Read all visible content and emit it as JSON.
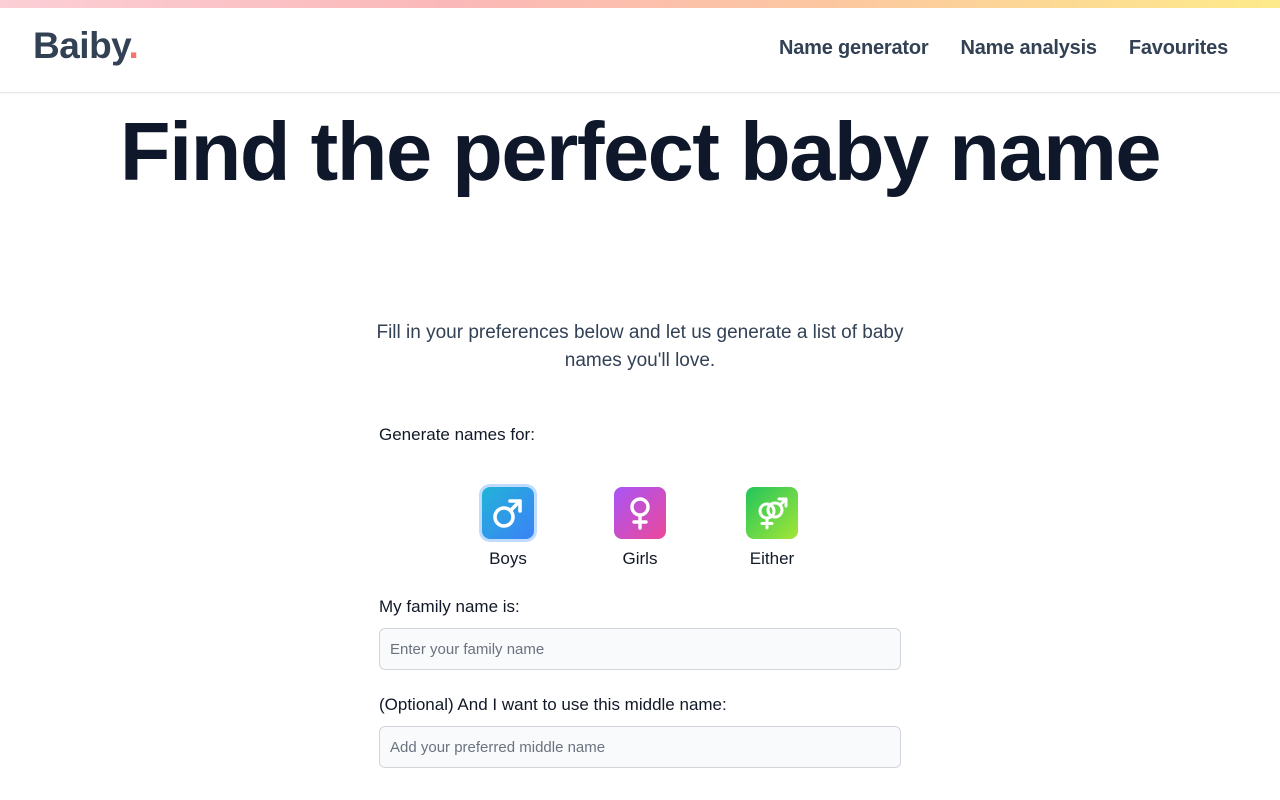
{
  "brand": {
    "name": "Baiby",
    "dot": ".",
    "dot_color": "#f87171"
  },
  "nav": {
    "items": [
      {
        "label": "Name generator"
      },
      {
        "label": "Name analysis"
      },
      {
        "label": "Favourites"
      }
    ]
  },
  "hero": {
    "title": "Find the perfect baby name",
    "subtitle": "Fill in your preferences below and let us generate a list of baby names you'll love."
  },
  "form": {
    "gender_label": "Generate names for:",
    "gender_options": [
      {
        "label": "Boys",
        "icon": "male-icon",
        "selected": true
      },
      {
        "label": "Girls",
        "icon": "female-icon",
        "selected": false
      },
      {
        "label": "Either",
        "icon": "gender-either-icon",
        "selected": false
      }
    ],
    "family_name_label": "My family name is:",
    "family_name_placeholder": "Enter your family name",
    "family_name_value": "",
    "middle_name_label": "(Optional) And I want to use this middle name:",
    "middle_name_placeholder": "Add your preferred middle name",
    "middle_name_value": ""
  },
  "colors": {
    "boys_gradient": [
      "#22b3d8",
      "#3b82f6"
    ],
    "girls_gradient": [
      "#a855f7",
      "#ec4899"
    ],
    "either_gradient": [
      "#22c55e",
      "#a3e635"
    ]
  }
}
